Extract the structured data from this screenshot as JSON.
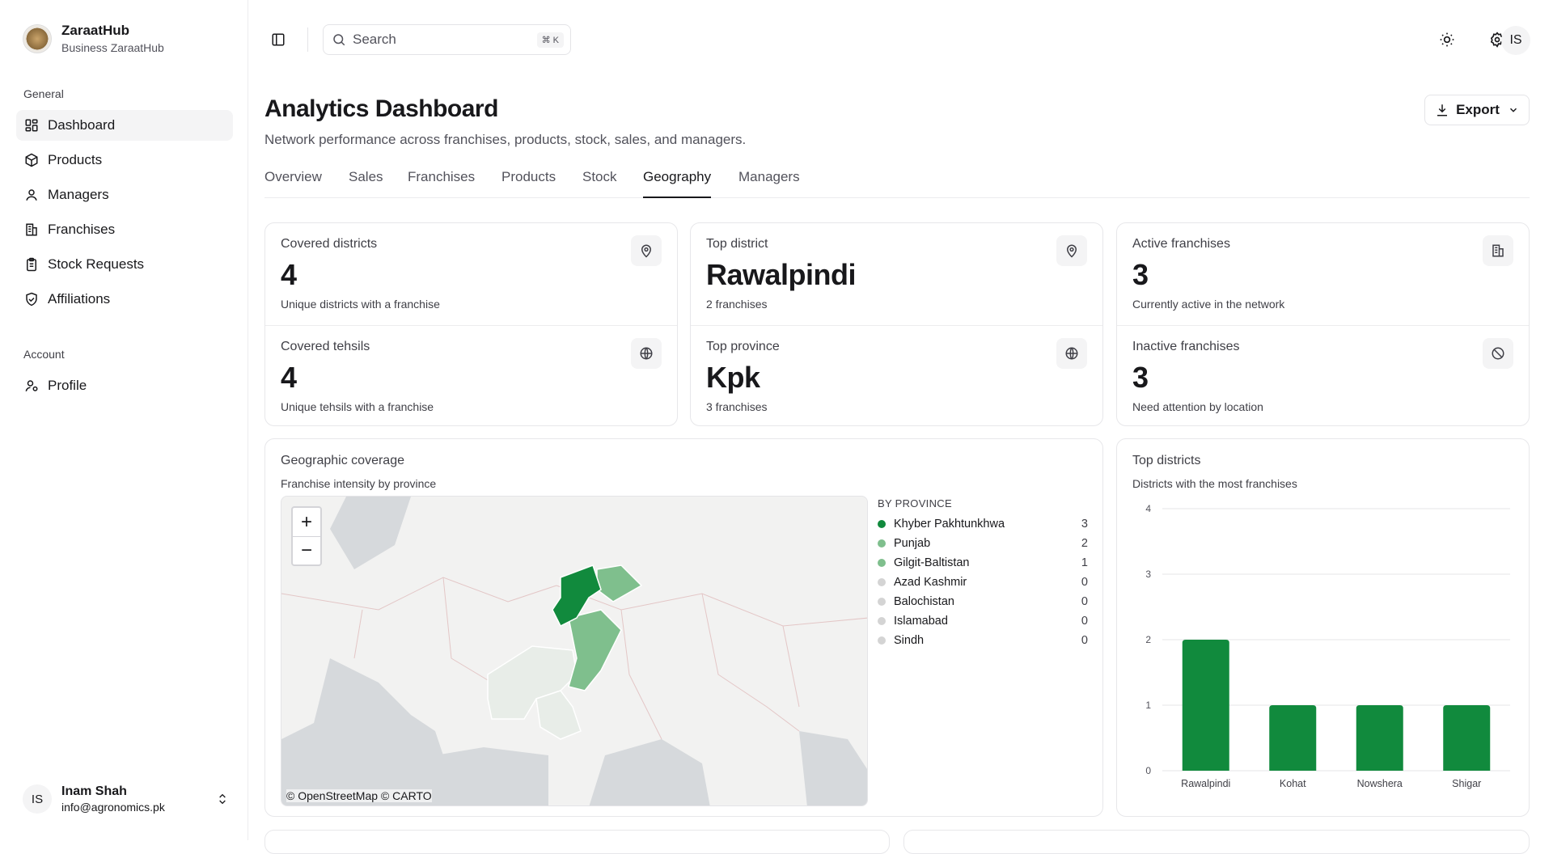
{
  "app": {
    "name": "ZaraatHub",
    "subtitle": "Business ZaraatHub"
  },
  "sidebar": {
    "general_label": "General",
    "general": [
      {
        "label": "Dashboard",
        "icon": "dashboard-icon"
      },
      {
        "label": "Products",
        "icon": "package-icon"
      },
      {
        "label": "Managers",
        "icon": "user-icon"
      },
      {
        "label": "Franchises",
        "icon": "building-icon"
      },
      {
        "label": "Stock Requests",
        "icon": "clipboard-icon"
      },
      {
        "label": "Affiliations",
        "icon": "shield-icon"
      }
    ],
    "account_label": "Account",
    "account": [
      {
        "label": "Profile",
        "icon": "user-cog-icon"
      }
    ],
    "user": {
      "initials": "IS",
      "name": "Inam Shah",
      "email": "info@agronomics.pk"
    }
  },
  "topbar": {
    "search_placeholder": "Search",
    "shortcut": "⌘ K",
    "avatar": "IS"
  },
  "page": {
    "title": "Analytics Dashboard",
    "subtitle": "Network performance across franchises, products, stock, sales, and managers.",
    "export_label": "Export"
  },
  "tabs": [
    "Overview",
    "Sales",
    "Franchises",
    "Products",
    "Stock",
    "Geography",
    "Managers"
  ],
  "active_tab": "Geography",
  "stats": {
    "covered_districts": {
      "title": "Covered districts",
      "value": "4",
      "desc": "Unique districts with a franchise"
    },
    "covered_tehsils": {
      "title": "Covered tehsils",
      "value": "4",
      "desc": "Unique tehsils with a franchise"
    },
    "top_district": {
      "title": "Top district",
      "value": "Rawalpindi",
      "desc": "2 franchises"
    },
    "top_province": {
      "title": "Top province",
      "value": "Kpk",
      "desc": "3 franchises"
    },
    "active_franchises": {
      "title": "Active franchises",
      "value": "3",
      "desc": "Currently active in the network"
    },
    "inactive_franchises": {
      "title": "Inactive franchises",
      "value": "3",
      "desc": "Need attention by location"
    }
  },
  "geo": {
    "title": "Geographic coverage",
    "subtitle": "Franchise intensity by province",
    "legend_title": "BY PROVINCE",
    "provinces": [
      {
        "name": "Khyber Pakhtunkhwa",
        "count": "3",
        "color": "#118a3d"
      },
      {
        "name": "Punjab",
        "count": "2",
        "color": "#7fbf8d"
      },
      {
        "name": "Gilgit-Baltistan",
        "count": "1",
        "color": "#7fbf8d"
      },
      {
        "name": "Azad Kashmir",
        "count": "0",
        "color": "#d4d4d4"
      },
      {
        "name": "Balochistan",
        "count": "0",
        "color": "#d4d4d4"
      },
      {
        "name": "Islamabad",
        "count": "0",
        "color": "#d4d4d4"
      },
      {
        "name": "Sindh",
        "count": "0",
        "color": "#d4d4d4"
      }
    ],
    "attribution": "© OpenStreetMap © CARTO"
  },
  "top_districts": {
    "title": "Top districts",
    "subtitle": "Districts with the most franchises"
  },
  "chart_data": {
    "type": "bar",
    "categories": [
      "Rawalpindi",
      "Kohat",
      "Nowshera",
      "Shigar"
    ],
    "values": [
      2,
      1,
      1,
      1
    ],
    "title": "Top districts",
    "ylim": [
      0,
      4
    ],
    "yticks": [
      "0",
      "1",
      "2",
      "3",
      "4"
    ],
    "color": "#118a3d",
    "grid": true
  }
}
